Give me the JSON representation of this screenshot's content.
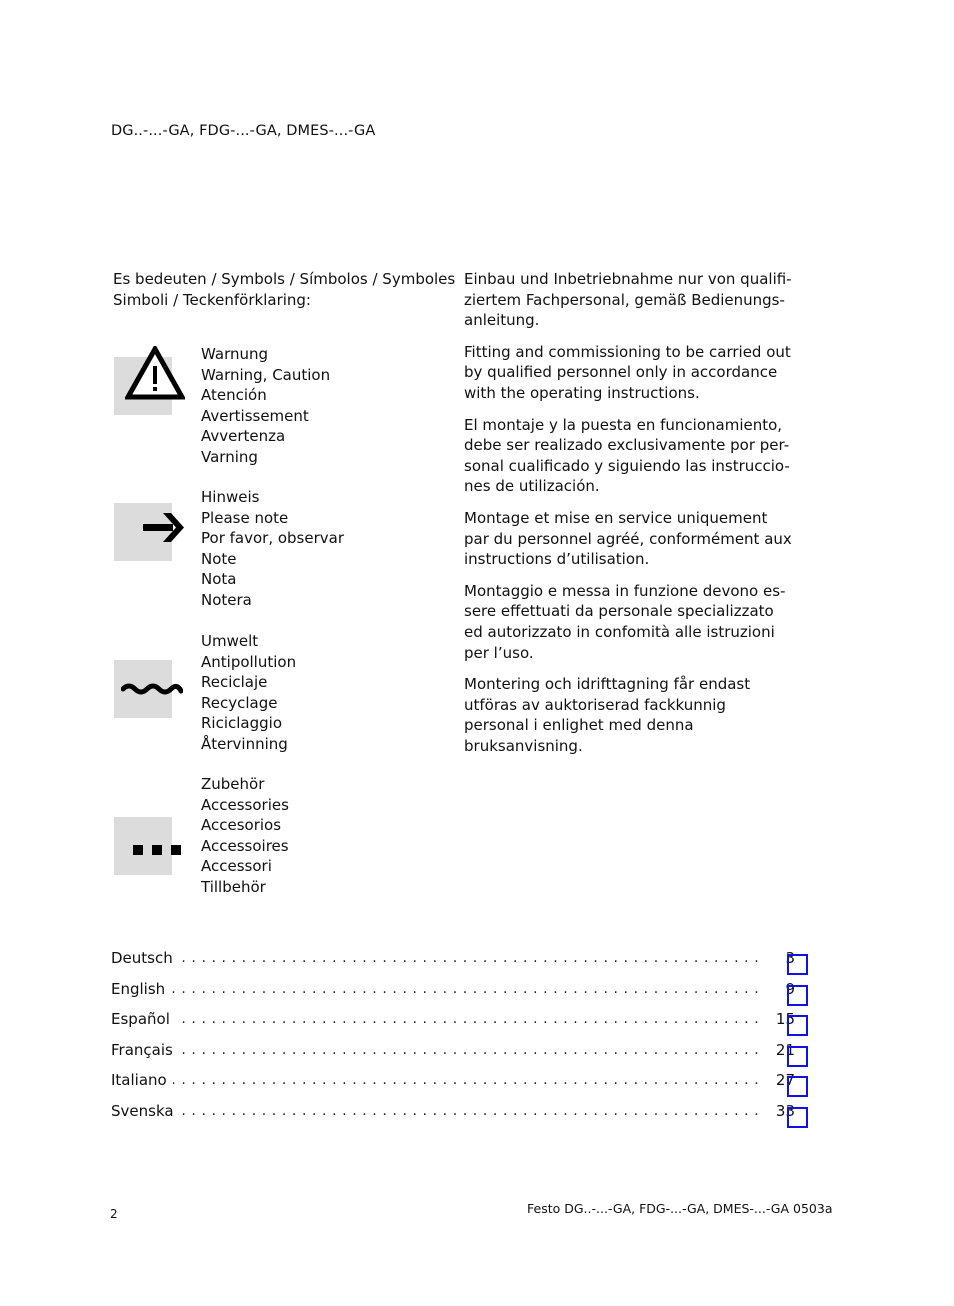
{
  "header": {
    "title": "DG..-...-GA, FDG-...-GA, DMES-...-GA"
  },
  "symbols_intro": {
    "line1": "Es bedeuten / Symbols / Símbolos / Symboles",
    "line2": "Simboli / Teckenförklaring:"
  },
  "symbols": [
    {
      "icon": "warning-triangle-icon",
      "labels": [
        "Warnung",
        "Warning, Caution",
        "Atención",
        "Avertissement",
        "Avvertenza",
        "Varning"
      ]
    },
    {
      "icon": "arrow-right-icon",
      "labels": [
        "Hinweis",
        "Please note",
        "Por favor, observar",
        "Note",
        "Nota",
        "Notera"
      ]
    },
    {
      "icon": "wave-environment-icon",
      "labels": [
        "Umwelt",
        "Antipollution",
        "Reciclaje",
        "Recyclage",
        "Riciclaggio",
        "Återvinning"
      ]
    },
    {
      "icon": "dots-accessories-icon",
      "labels": [
        "Zubehör",
        "Accessories",
        "Accesorios",
        "Accessoires",
        "Accessori",
        "Tillbehör"
      ]
    }
  ],
  "notices": [
    "Einbau und Inbetriebnahme nur von qualifi-ziertem Fachpersonal, gemäß Bedienungs-anleitung.",
    "Fitting and commissioning to be carried out by qualified personnel only in accordance with the operating instructions.",
    "El montaje y la puesta en funcionamiento, debe ser realizado exclusivamente por per-sonal cualificado y siguiendo las instruccio-nes de utilización.",
    "Montage et mise en service uniquement par du personnel agréé, conformément aux instructions d’utilisation.",
    "Montaggio e messa in funzione devono es-sere effettuati da personale specializzato ed autorizzato in confomità alle istruzioni per l’uso.",
    "Montering och idrifttagning får endast utföras av auktoriserad fackkunnig personal i enlighet med denna bruksanvisning."
  ],
  "toc": [
    {
      "label": "Deutsch",
      "page": "3"
    },
    {
      "label": "English",
      "page": "9"
    },
    {
      "label": "Español",
      "page": "15"
    },
    {
      "label": "Français",
      "page": "21"
    },
    {
      "label": "Italiano",
      "page": "27"
    },
    {
      "label": "Svenska",
      "page": "33"
    }
  ],
  "toc_dots": "....................................................................................................",
  "footer": {
    "page_number": "2",
    "doc_id": "Festo DG..-...-GA, FDG-...-GA, DMES-...-GA 0503a"
  }
}
